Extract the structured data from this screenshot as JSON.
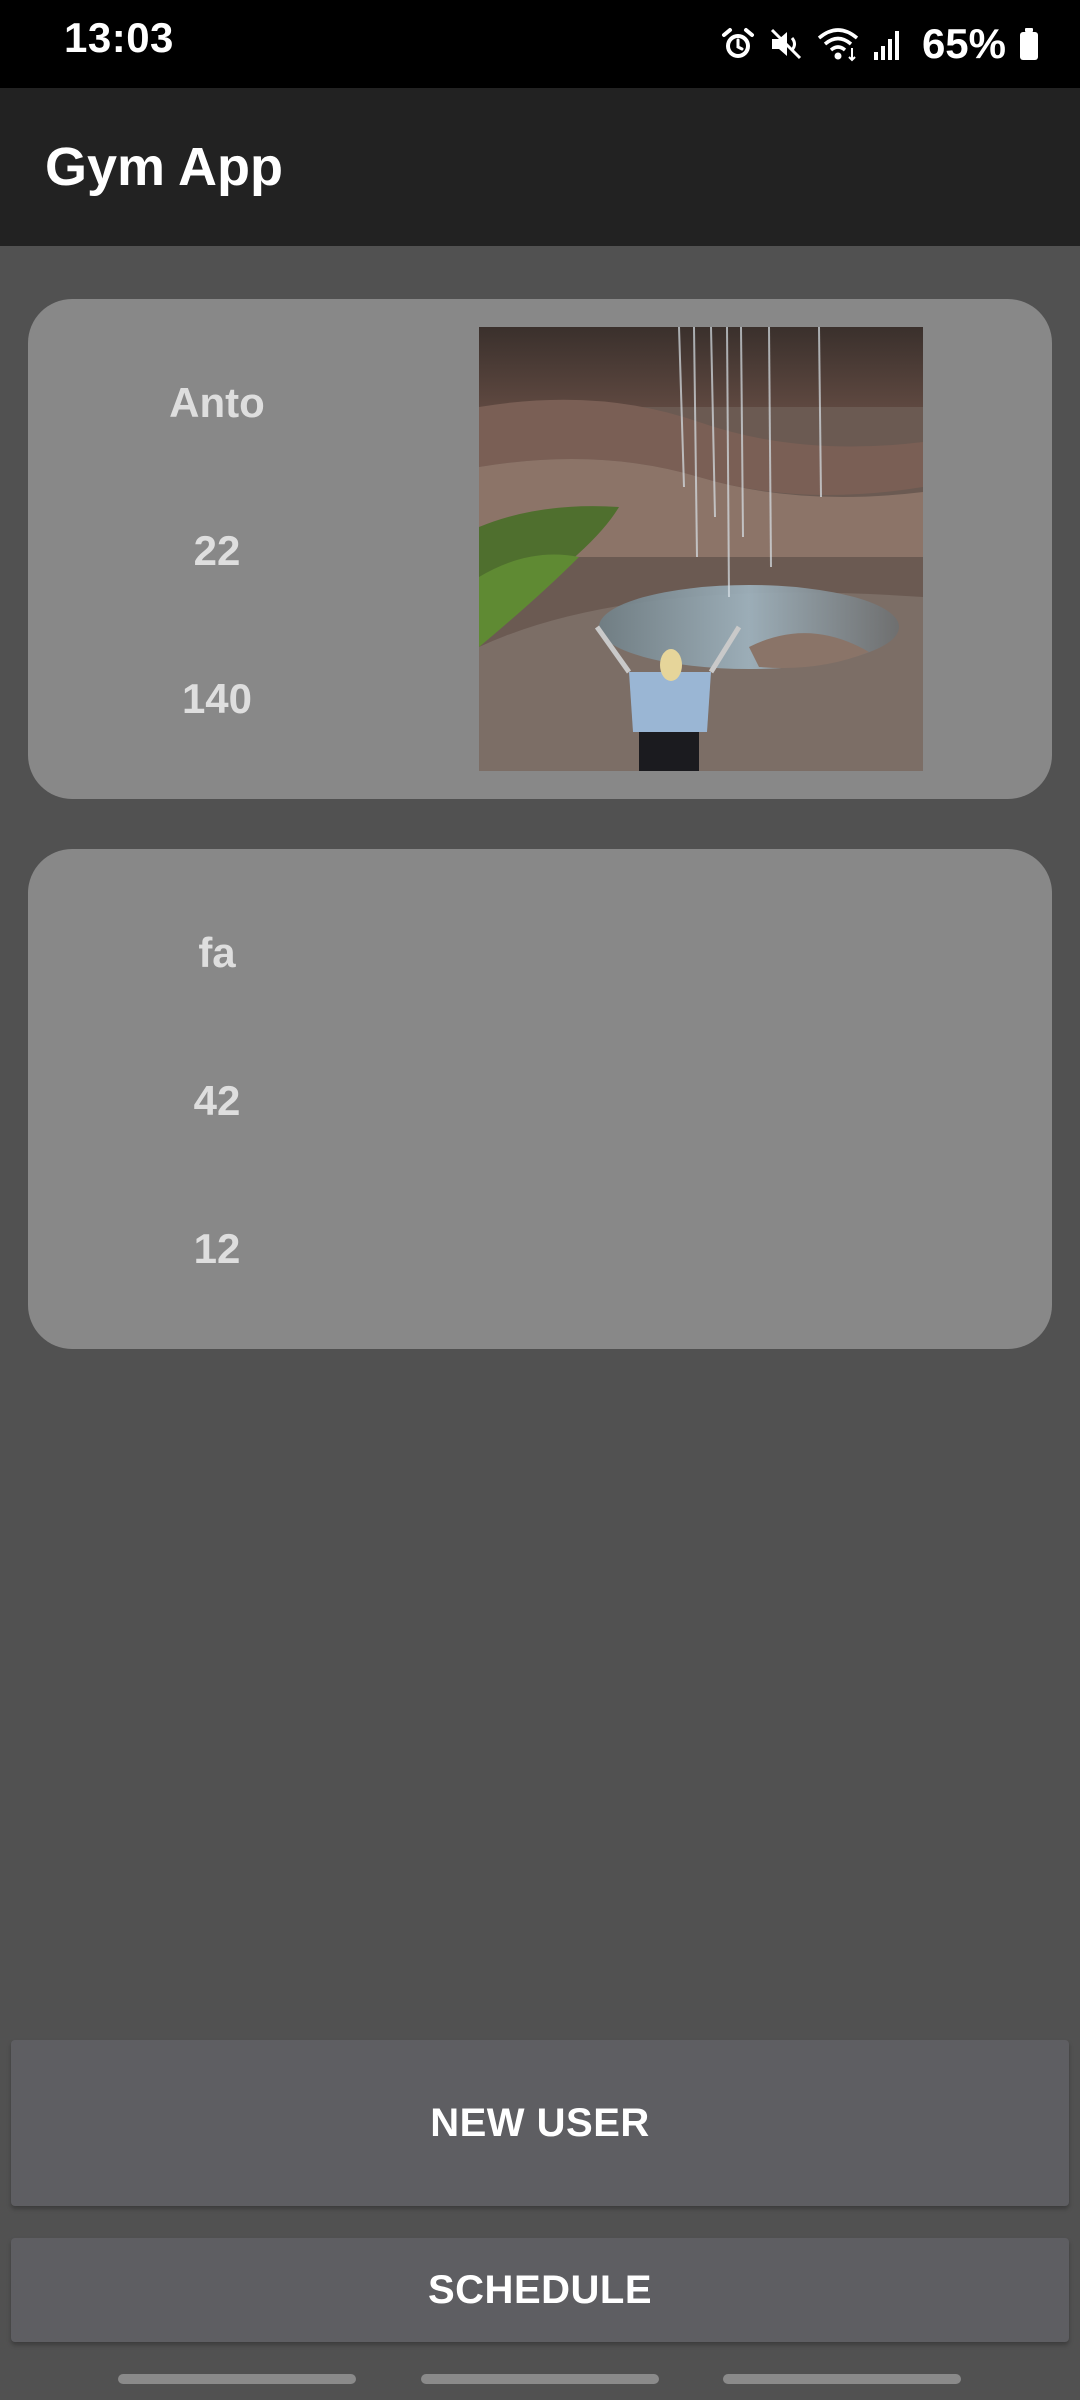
{
  "status_bar": {
    "time": "13:03",
    "battery_percent": "65%",
    "icons": [
      "alarm-icon",
      "mute-icon",
      "wifi-icon",
      "signal-icon",
      "battery-icon"
    ]
  },
  "app_bar": {
    "title": "Gym App"
  },
  "users": [
    {
      "name": "Anto",
      "age": "22",
      "weight": "140",
      "has_photo": true
    },
    {
      "name": "fa",
      "age": "42",
      "weight": "12",
      "has_photo": false
    }
  ],
  "buttons": {
    "new_user": "NEW USER",
    "schedule": "SCHEDULE"
  },
  "colors": {
    "background": "#515151",
    "app_bar": "#222222",
    "card": "#888888",
    "button": "#5e5e62"
  }
}
